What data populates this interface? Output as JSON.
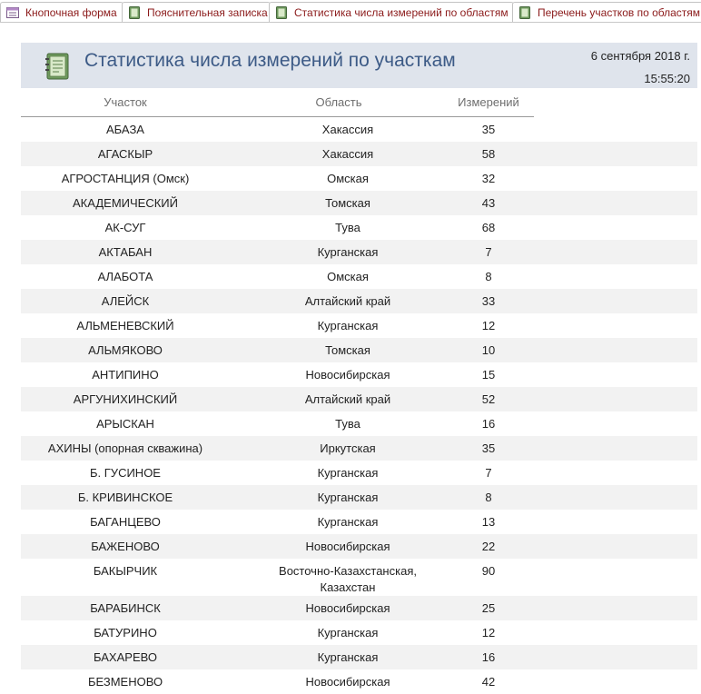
{
  "tabs": [
    {
      "label": "Кнопочная форма",
      "icon": "form-icon",
      "width": 136
    },
    {
      "label": "Пояснительная записка",
      "icon": "report-icon",
      "width": 164
    },
    {
      "label": "Статистика числа измерений по областям",
      "icon": "report-icon",
      "width": 270
    },
    {
      "label": "Перечень участков по областям",
      "icon": "report-icon",
      "width": 210
    }
  ],
  "report": {
    "title": "Статистика числа измерений по участкам",
    "date": "6 сентября 2018 г.",
    "time": "15:55:20",
    "icon": "report-book-icon"
  },
  "columns": {
    "site": "Участок",
    "region": "Область",
    "count": "Измерений"
  },
  "rows": [
    {
      "site": "АБАЗА",
      "region": "Хакассия",
      "count": "35"
    },
    {
      "site": "АГАСКЫР",
      "region": "Хакассия",
      "count": "58"
    },
    {
      "site": "АГРОСТАНЦИЯ (Омск)",
      "region": "Омская",
      "count": "32"
    },
    {
      "site": "АКАДЕМИЧЕСКИЙ",
      "region": "Томская",
      "count": "43"
    },
    {
      "site": "АК-СУГ",
      "region": "Тува",
      "count": "68"
    },
    {
      "site": "АКТАБАН",
      "region": "Курганская",
      "count": "7"
    },
    {
      "site": "АЛАБОТА",
      "region": "Омская",
      "count": "8"
    },
    {
      "site": "АЛЕЙСК",
      "region": "Алтайский край",
      "count": "33"
    },
    {
      "site": "АЛЬМЕНЕВСКИЙ",
      "region": "Курганская",
      "count": "12"
    },
    {
      "site": "АЛЬМЯКОВО",
      "region": "Томская",
      "count": "10"
    },
    {
      "site": "АНТИПИНО",
      "region": "Новосибирская",
      "count": "15"
    },
    {
      "site": "АРГУНИХИНСКИЙ",
      "region": "Алтайский край",
      "count": "52"
    },
    {
      "site": "АРЫСКАН",
      "region": "Тува",
      "count": "16"
    },
    {
      "site": "АХИНЫ (опорная скважина)",
      "region": "Иркутская",
      "count": "35"
    },
    {
      "site": "Б. ГУСИНОЕ",
      "region": "Курганская",
      "count": "7"
    },
    {
      "site": "Б. КРИВИНСКОЕ",
      "region": "Курганская",
      "count": "8"
    },
    {
      "site": "БАГАНЦЕВО",
      "region": "Курганская",
      "count": "13"
    },
    {
      "site": "БАЖЕНОВО",
      "region": "Новосибирская",
      "count": "22"
    },
    {
      "site": "БАКЫРЧИК",
      "region": "Восточно-Казахстанская, Казахстан",
      "count": "90"
    },
    {
      "site": "БАРАБИНСК",
      "region": "Новосибирская",
      "count": "25"
    },
    {
      "site": "БАТУРИНО",
      "region": "Курганская",
      "count": "12"
    },
    {
      "site": "БАХАРЕВО",
      "region": "Курганская",
      "count": "16"
    },
    {
      "site": "БЕЗМЕНОВО",
      "region": "Новосибирская",
      "count": "42"
    }
  ],
  "colors": {
    "tab_text": "#8b1a1a",
    "title_text": "#3c5a86",
    "header_bg": "#dfe4ec",
    "alt_row_bg": "#f2f2f2"
  }
}
